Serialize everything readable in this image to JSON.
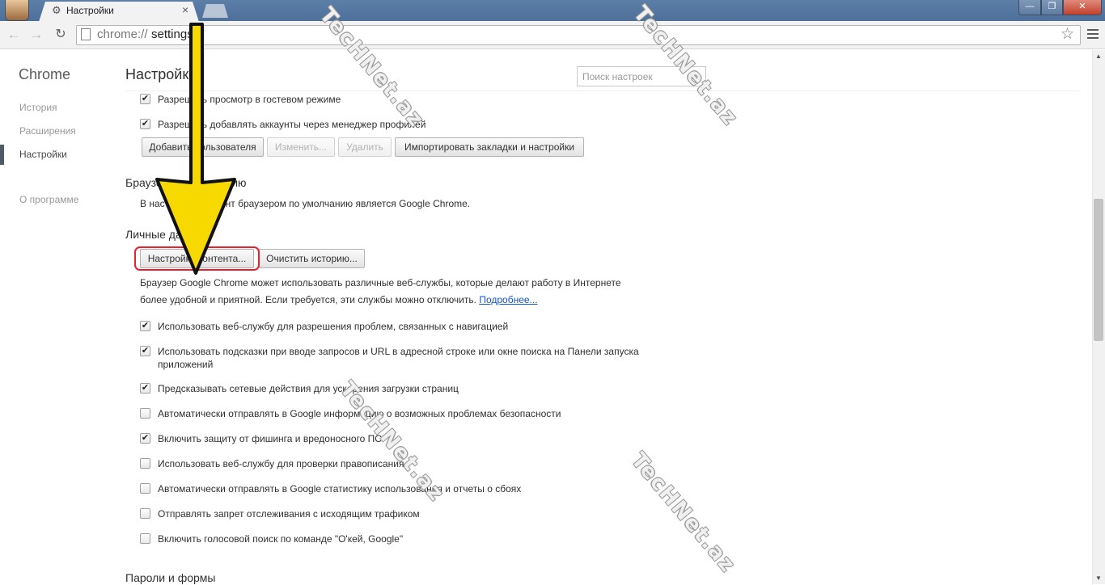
{
  "browser": {
    "tab_title": "Настройки",
    "tab_icon": "gear-icon",
    "tab_close": "×",
    "url_scheme": "chrome://",
    "url_rest": "settings",
    "window_min": "—",
    "window_max": "❐",
    "window_close": "✕",
    "back": "←",
    "forward": "→",
    "reload": "↻",
    "star": "☆"
  },
  "sidebar": {
    "brand": "Chrome",
    "items": [
      {
        "label": "История"
      },
      {
        "label": "Расширения"
      },
      {
        "label": "Настройки"
      },
      {
        "label": "О программе"
      }
    ]
  },
  "main": {
    "title": "Настройки",
    "search_placeholder": "Поиск настроек",
    "users": {
      "checkboxes": [
        {
          "label": "Разрешить просмотр в гостевом режиме",
          "checked": true
        },
        {
          "label": "Разрешить добавлять аккаунты через менеджер профилей",
          "checked": true
        }
      ],
      "buttons": {
        "add": "Добавить пользователя",
        "edit": "Изменить...",
        "delete": "Удалить",
        "import": "Импортировать закладки и настройки"
      }
    },
    "default_browser": {
      "title": "Браузер по умолчанию",
      "text": "В настоящий момент браузером по умолчанию является Google Chrome."
    },
    "privacy": {
      "title": "Личные данные",
      "content_settings": "Настройки контента...",
      "clear_history": "Очистить историю...",
      "desc_line1": "Браузер Google Chrome может использовать различные веб-службы, которые делают работу в Интернете",
      "desc_line2": "более удобной и приятной. Если требуется, эти службы можно отключить.",
      "more_link": "Подробнее...",
      "options": [
        {
          "label": "Использовать веб-службу для разрешения проблем, связанных с навигацией",
          "checked": true
        },
        {
          "label": "Использовать подсказки при вводе запросов и URL в адресной строке или окне поиска на Панели запуска",
          "label2": "приложений",
          "checked": true
        },
        {
          "label": "Предсказывать сетевые действия для ускорения загрузки страниц",
          "checked": true
        },
        {
          "label": "Автоматически отправлять в Google информацию о возможных проблемах безопасности",
          "checked": false
        },
        {
          "label": "Включить защиту от фишинга и вредоносного ПО",
          "checked": true
        },
        {
          "label": "Использовать веб-службу для проверки правописания",
          "checked": false
        },
        {
          "label": "Автоматически отправлять в Google статистику использования и отчеты о сбоях",
          "checked": false
        },
        {
          "label": "Отправлять запрет отслеживания с исходящим трафиком",
          "checked": false
        },
        {
          "label": "Включить голосовой поиск по команде \"О'кей, Google\"",
          "checked": false
        }
      ]
    },
    "passwords": {
      "title": "Пароли и формы"
    }
  },
  "watermark": "TecHNet.az",
  "colors": {
    "arrow_fill": "#f7d900",
    "arrow_stroke": "#111111",
    "highlight": "#e8212a",
    "link": "#1155cc"
  },
  "check_glyph": "✔"
}
